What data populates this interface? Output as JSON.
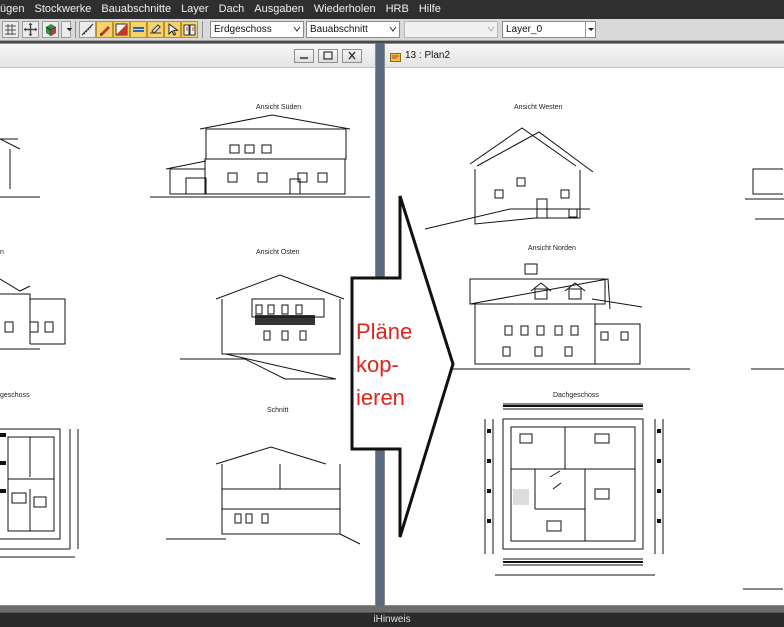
{
  "menu": {
    "items": [
      "ügen",
      "Stockwerke",
      "Bauabschnitte",
      "Layer",
      "Dach",
      "Ausgaben",
      "Wiederholen",
      "HRB",
      "Hilfe"
    ]
  },
  "toolbar": {
    "dropdowns": {
      "floor": "Erdgeschoss",
      "section": "Bauabschnitt",
      "empty": "",
      "layer": "Layer_0"
    }
  },
  "windows": {
    "left": {
      "title": "",
      "views": {
        "south": "Ansicht Süden",
        "east": "Ansicht Osten",
        "section": "Schnitt",
        "west_partial": "n",
        "floor_partial": "geschoss"
      }
    },
    "right": {
      "title": "13 : Plan2",
      "views": {
        "west": "Ansicht Westen",
        "north": "Ansicht Norden",
        "attic": "Dachgeschoss"
      }
    }
  },
  "callout": {
    "text": "Pläne\nkop-\nieren",
    "color": "#e2231a"
  },
  "status": {
    "hint": "iHinweis"
  },
  "colors": {
    "highlight_button": "#f5d26b",
    "window_gap": "#5a6a80"
  }
}
